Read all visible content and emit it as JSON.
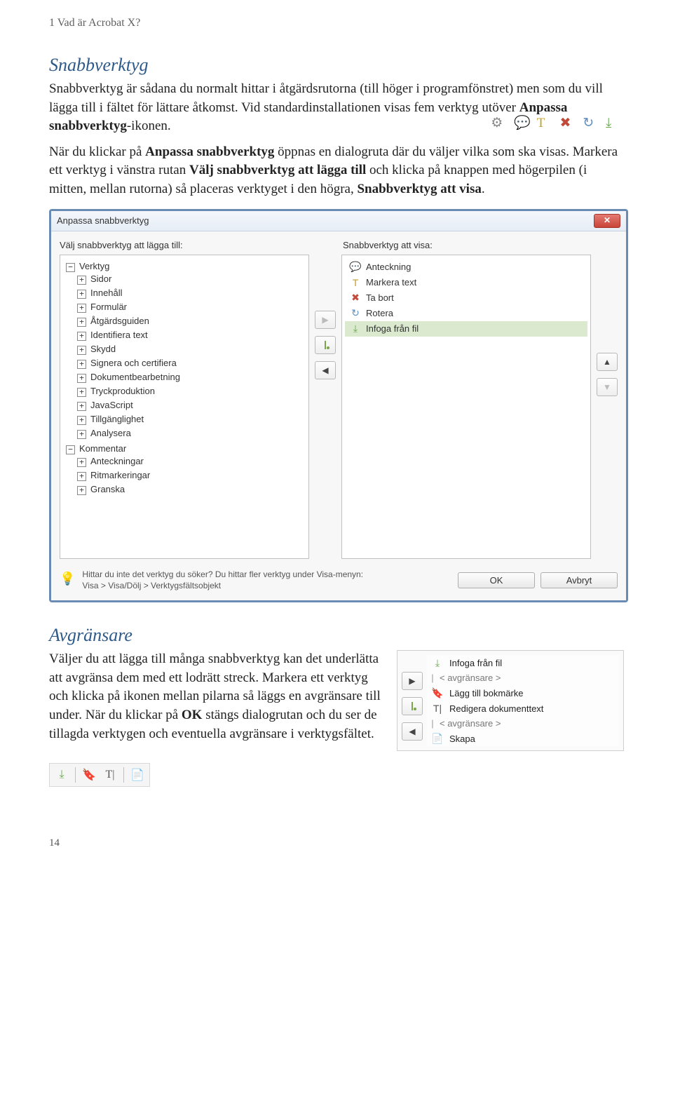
{
  "header": {
    "breadcrumb": "1 Vad är Acrobat X?"
  },
  "section1": {
    "title": "Snabbverktyg",
    "para1_a": "Snabbverktyg är sådana du normalt hittar i åtgärdsrutorna (till höger i programfönstret) men som du vill lägga till i fältet för lättare åtkomst. Vid standardinstallationen visas fem verktyg utöver ",
    "para1_b": "Anpassa snabbverktyg",
    "para1_c": "-ikonen.",
    "para2_a": "När du klickar på ",
    "para2_b": "Anpassa snabbverktyg",
    "para2_c": " öppnas en dialogruta där du väljer vilka som ska visas. Markera ett verktyg i vänstra rutan ",
    "para2_d": "Välj snabbverktyg att lägga till",
    "para2_e": " och klicka på knappen med högerpilen (i mitten, mellan rutorna) så placeras verktyget i den högra, ",
    "para2_f": "Snabbverktyg att visa",
    "para2_g": "."
  },
  "toolbar_icons": [
    "gear-icon",
    "note-icon",
    "highlight-icon",
    "remove-icon",
    "rotate-icon",
    "insert-icon"
  ],
  "dialog": {
    "title": "Anpassa snabbverktyg",
    "close_tooltip": "Stäng",
    "left_label": "Välj snabbverktyg att lägga till:",
    "right_label": "Snabbverktyg att visa:",
    "tree": {
      "root1": "Verktyg",
      "children1": [
        "Sidor",
        "Innehåll",
        "Formulär",
        "Åtgärdsguiden",
        "Identifiera text",
        "Skydd",
        "Signera och certifiera",
        "Dokumentbearbetning",
        "Tryckproduktion",
        "JavaScript",
        "Tillgänglighet",
        "Analysera"
      ],
      "root2": "Kommentar",
      "children2": [
        "Anteckningar",
        "Ritmarkeringar",
        "Granska"
      ]
    },
    "right_list": [
      {
        "label": "Anteckning",
        "icon": "note",
        "selected": false
      },
      {
        "label": "Markera text",
        "icon": "highlight",
        "selected": false
      },
      {
        "label": "Ta bort",
        "icon": "remove",
        "selected": false
      },
      {
        "label": "Rotera",
        "icon": "rotate",
        "selected": false
      },
      {
        "label": "Infoga från fil",
        "icon": "insert",
        "selected": true
      }
    ],
    "center_buttons": {
      "move_right": "▶",
      "add_sep": "|₀",
      "move_left": "◀"
    },
    "side_buttons": {
      "up": "▲",
      "down": "▼"
    },
    "hint_line1": "Hittar du inte det verktyg du söker? Du hittar fler verktyg under Visa-menyn:",
    "hint_line2": "Visa > Visa/Dölj > Verktygsfältsobjekt",
    "ok": "OK",
    "cancel": "Avbryt"
  },
  "section2": {
    "title": "Avgränsare",
    "para_a": "Väljer du att lägga till många snabbverktyg kan det underlätta att avgränsa dem med ett lodrätt streck. Markera ett verktyg och klicka på ikonen mellan pilarna så läggs en avgränsare till under. När du klickar på ",
    "para_b": "OK",
    "para_c": " stängs dialogrutan och du ser de tillagda verktygen och eventuella avgränsare i verktygsfältet."
  },
  "mini_panel": {
    "items": [
      {
        "label": "Infoga från fil",
        "icon": "insert"
      },
      {
        "label": "< avgränsare >",
        "icon": "sep"
      },
      {
        "label": "Lägg till bokmärke",
        "icon": "bookmark"
      },
      {
        "label": "Redigera dokumenttext",
        "icon": "textedit"
      },
      {
        "label": "< avgränsare >",
        "icon": "sep"
      },
      {
        "label": "Skapa",
        "icon": "create"
      }
    ]
  },
  "bottom_bar_icons": [
    "insert-icon",
    "bookmark-icon",
    "textedit-icon",
    "create-icon"
  ],
  "page_number": "14"
}
